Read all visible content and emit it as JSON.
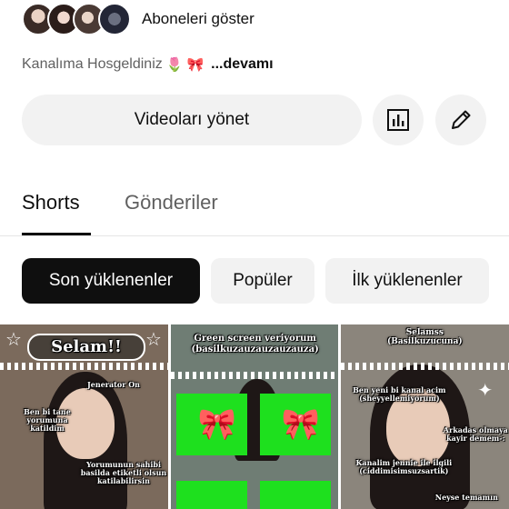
{
  "subscribers": {
    "link_label": "Aboneleri göster"
  },
  "description": {
    "text": "Kanalıma Hosgeldiniz",
    "emoji": [
      "🌷",
      "🎀"
    ],
    "more_label": "...devamı"
  },
  "actions": {
    "manage_videos_label": "Videoları yönet",
    "stats_icon": "bar-chart-icon",
    "edit_icon": "pencil-icon"
  },
  "tabs": [
    {
      "label": "Shorts",
      "selected": true
    },
    {
      "label": "Gönderiler",
      "selected": false
    }
  ],
  "filters": [
    {
      "label": "Son yüklenenler",
      "selected": true
    },
    {
      "label": "Popüler",
      "selected": false
    },
    {
      "label": "İlk yüklenenler",
      "selected": false
    }
  ],
  "shorts": [
    {
      "title_overlay": "Selam!!",
      "captions": [
        "Jenerator On",
        "Ben bi tane yorumuna katildim",
        "Yorumunun sahibi basilda etiketli olsun katilabilirsin"
      ]
    },
    {
      "title_overlay": "Green screen veriyorum (basilkuzauzauzauzauza)",
      "captions": []
    },
    {
      "title_overlay": "Selamss (Basilkuzucuna)",
      "captions": [
        "Ben yeni bi kanal acim (sheyyellemiyorum)",
        "Arkadas olmaya kayir demem-:",
        "Kanalim jennie ile ilgili (ciddimisimsuzsartik)",
        "Neyse temamın"
      ]
    }
  ]
}
